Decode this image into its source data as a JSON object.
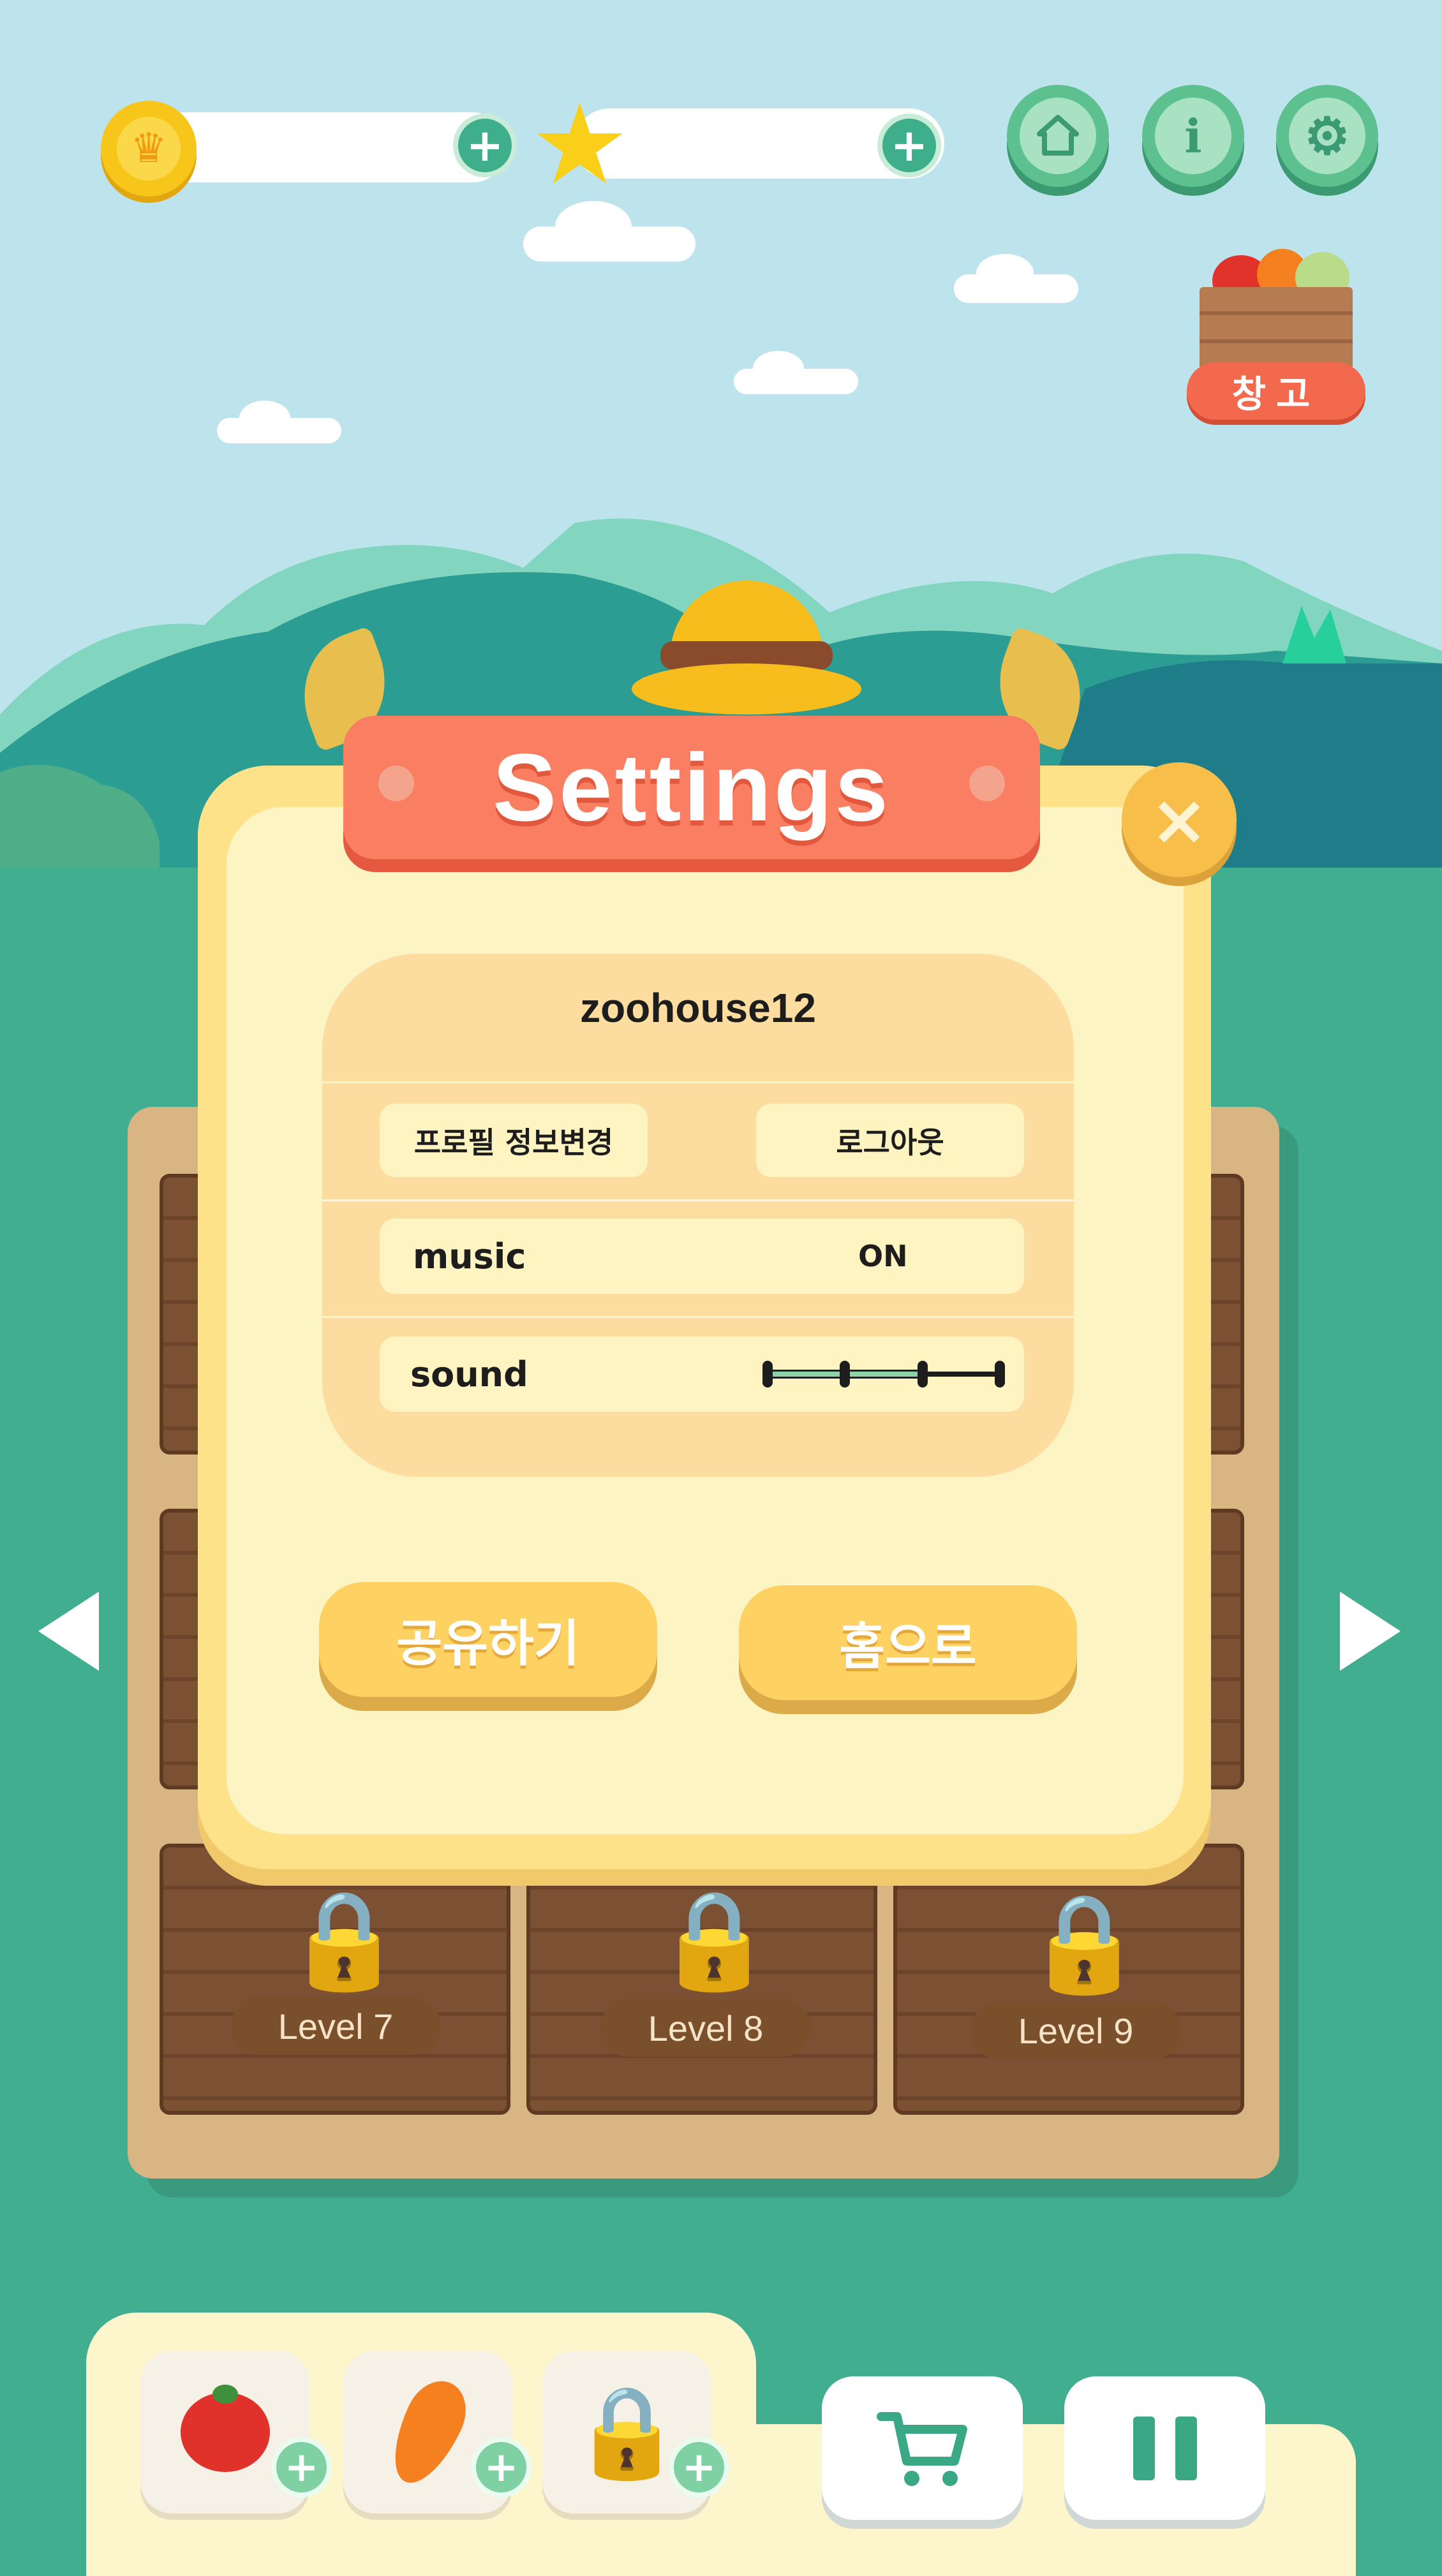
{
  "top_bar": {
    "coins": "",
    "stars": "",
    "add_coins_label": "+",
    "add_stars_label": "+",
    "home_icon": "home-icon",
    "info_label": "i",
    "settings_icon": "gear-icon"
  },
  "storage": {
    "label": "창고"
  },
  "settings": {
    "title": "Settings",
    "close_label": "×",
    "username": "zoohouse12",
    "edit_profile_label": "프로필 정보변경",
    "logout_label": "로그아웃",
    "music": {
      "label": "music",
      "value": "ON"
    },
    "sound": {
      "label": "sound",
      "level": 0.67
    },
    "share_label": "공유하기",
    "home_label": "홈으로"
  },
  "levels": [
    {
      "label": "Level 7",
      "locked": true
    },
    {
      "label": "Level 8",
      "locked": true
    },
    {
      "label": "Level 9",
      "locked": true
    }
  ],
  "inventory": [
    {
      "item": "tomato",
      "icon": "tomato-icon"
    },
    {
      "item": "carrot",
      "icon": "carrot-icon"
    },
    {
      "item": "locked",
      "icon": "lock-icon"
    }
  ],
  "toolbar": {
    "cart_icon": "cart-icon",
    "pause_icon": "pause-icon"
  },
  "colors": {
    "sky": "#bde4ec",
    "ground": "#42ae90",
    "accent_green": "#3fae8a",
    "banner": "#f97e62",
    "modal": "#fde28a",
    "button_yellow": "#fdd262"
  }
}
